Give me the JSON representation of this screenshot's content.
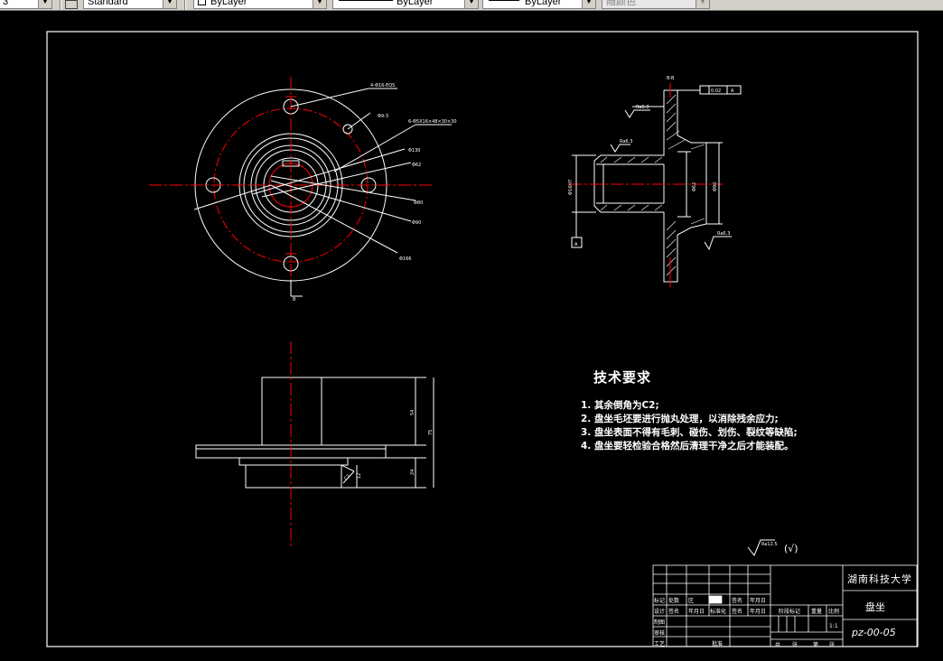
{
  "toolbar": {
    "text_style": "Standard",
    "layer_color": "ByLayer",
    "linetype": "ByLayer",
    "lineweight": "ByLayer",
    "plot_style": "随颜色",
    "first_item": "3"
  },
  "drawing": {
    "section_label": "B-B",
    "datum_ref": "A",
    "datum_box": "A",
    "cut_label": "B",
    "tolerance_text": "0.02",
    "roughness_1": "Ra6.3",
    "roughness_2": "Ra6.3",
    "roughness_3": "Ra6.3",
    "dim_dia_130": "Φ130",
    "dim_dia_62": "Φ62",
    "dim_dia_80": "Φ80",
    "dim_dia_90": "Φ90",
    "dim_dia_166": "Φ166",
    "dim_4holes": "4-Φ16-EQS",
    "dim_hole_b": "Φ9-3",
    "dim_spline": "6-Φ5X16×48×30×30",
    "dim_sec_62": "Φ62",
    "dim_sec_90": "Φ90",
    "dim_sec_left": "Φ16H7",
    "dim_h_total": "75",
    "dim_h_upper": "54",
    "dim_h_lower": "24",
    "dim_h_small": "12",
    "dim_chamfer": "C2"
  },
  "tech_req": {
    "title": "技术要求",
    "items": [
      "1. 其余倒角为C2;",
      "2. 盘坐毛坯要进行抛丸处理，以消除残余应力;",
      "3. 盘坐表面不得有毛刺、碰伤、划伤、裂纹等缺陷;",
      "4. 盘坐要轻检验合格然后清理干净之后才能装配。"
    ]
  },
  "roughness_note": {
    "value": "Ra12.5",
    "bracket": "(√)"
  },
  "title_block": {
    "school": "湖南科技大学",
    "part_name": "盘坐",
    "drawing_no": "pz-00-05",
    "row_revise": [
      "标记",
      "处数",
      "区",
      "",
      "签名",
      "年月日"
    ],
    "row_design": [
      "设计",
      "签名",
      "年月日",
      "标准化",
      "签名",
      "年月日"
    ],
    "stage_label": "阶段标记",
    "weight_label": "重量",
    "scale_label": "比例",
    "scale_value": "1:1",
    "rows_left": [
      "制图",
      "审核",
      "工艺"
    ],
    "approve_label": "批准",
    "sheet_total": "共",
    "sheet_label": "张",
    "sheet_no": "第",
    "sheet_label2": "张"
  },
  "colors": {
    "line": "#ffffff",
    "center": "#ff0000",
    "toolbar_bg": "#d4d0c8"
  }
}
